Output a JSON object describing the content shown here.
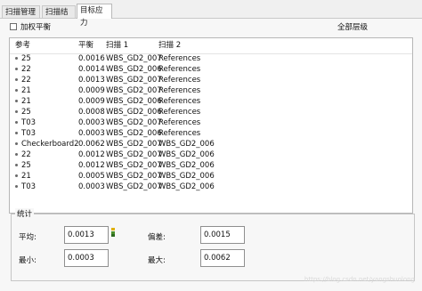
{
  "tabs": [
    {
      "label": "扫描管理器",
      "active": false
    },
    {
      "label": "扫描结果",
      "active": false
    },
    {
      "label": "目标应力",
      "active": true
    }
  ],
  "toolbar": {
    "weighted_balance_label": "加权平衡",
    "weighted_balance_checked": false,
    "scope_label": "全部层级"
  },
  "table": {
    "headers": [
      "参考",
      "平衡",
      "扫描 1",
      "扫描 2"
    ],
    "rows": [
      [
        "25",
        "0.0016",
        "WBS_GD2_007",
        "References"
      ],
      [
        "22",
        "0.0014",
        "WBS_GD2_006",
        "References"
      ],
      [
        "22",
        "0.0013",
        "WBS_GD2_007",
        "References"
      ],
      [
        "21",
        "0.0009",
        "WBS_GD2_007",
        "References"
      ],
      [
        "21",
        "0.0009",
        "WBS_GD2_006",
        "References"
      ],
      [
        "25",
        "0.0008",
        "WBS_GD2_006",
        "References"
      ],
      [
        "T03",
        "0.0003",
        "WBS_GD2_007",
        "References"
      ],
      [
        "T03",
        "0.0003",
        "WBS_GD2_006",
        "References"
      ],
      [
        "Checkerboard2",
        "0.0062",
        "WBS_GD2_007",
        "WBS_GD2_006"
      ],
      [
        "22",
        "0.0012",
        "WBS_GD2_007",
        "WBS_GD2_006"
      ],
      [
        "25",
        "0.0012",
        "WBS_GD2_007",
        "WBS_GD2_006"
      ],
      [
        "21",
        "0.0005",
        "WBS_GD2_007",
        "WBS_GD2_006"
      ],
      [
        "T03",
        "0.0003",
        "WBS_GD2_007",
        "WBS_GD2_006"
      ]
    ]
  },
  "stats": {
    "title": "统计",
    "avg_label": "平均:",
    "avg_value": "0.0013",
    "dev_label": "偏差:",
    "dev_value": "0.0015",
    "min_label": "最小:",
    "min_value": "0.0003",
    "max_label": "最大:",
    "max_value": "0.0062"
  },
  "watermark": "https://blog.csdn.net/yangshuolong",
  "colors": {
    "traffic_light": [
      "#e0b000",
      "#4a8f2a",
      "#2d6b1f"
    ]
  }
}
